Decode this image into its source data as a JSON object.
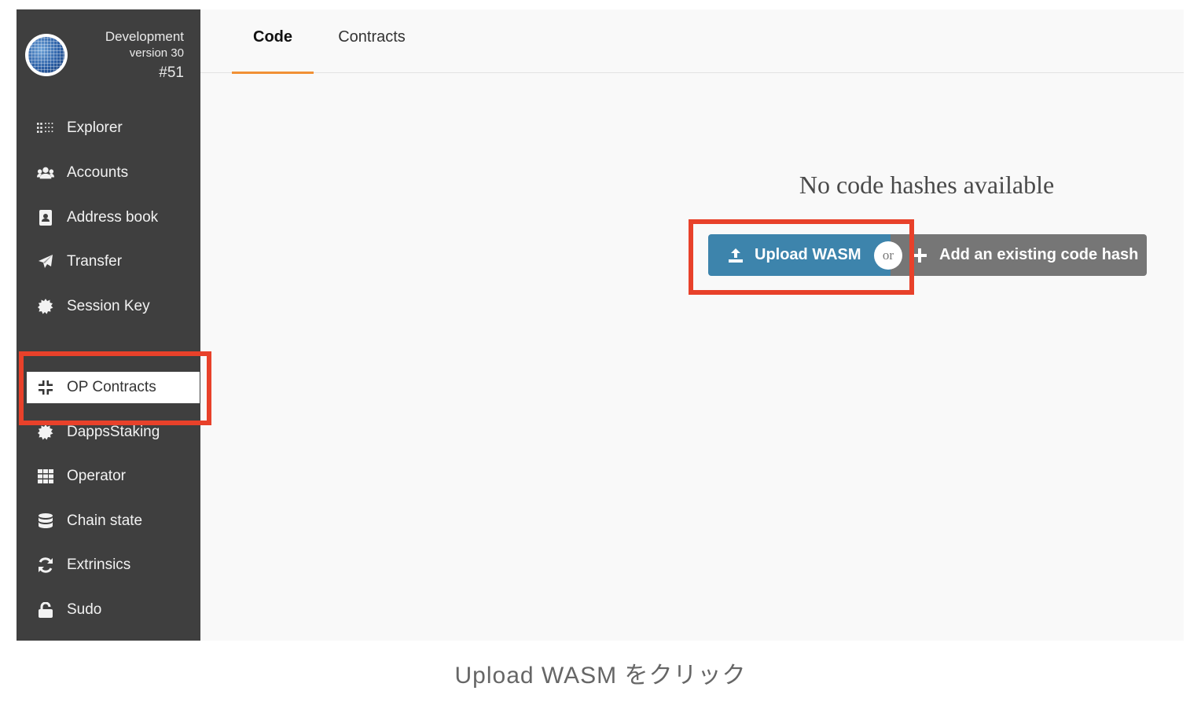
{
  "chain": {
    "name": "Development",
    "version": "version 30",
    "block": "#51"
  },
  "sidebar": {
    "items": [
      {
        "label": "Explorer",
        "icon": "explorer-dots-icon"
      },
      {
        "label": "Accounts",
        "icon": "users-icon"
      },
      {
        "label": "Address book",
        "icon": "address-book-icon"
      },
      {
        "label": "Transfer",
        "icon": "paper-plane-icon"
      },
      {
        "label": "Session Key",
        "icon": "certificate-icon"
      },
      {
        "label": "OP Contracts",
        "icon": "compress-icon"
      },
      {
        "label": "DappsStaking",
        "icon": "certificate-icon"
      },
      {
        "label": "Operator",
        "icon": "grid-icon"
      },
      {
        "label": "Chain state",
        "icon": "database-icon"
      },
      {
        "label": "Extrinsics",
        "icon": "sync-icon"
      },
      {
        "label": "Sudo",
        "icon": "unlock-icon"
      }
    ],
    "active": "OP Contracts"
  },
  "tabs": [
    {
      "label": "Code",
      "active": true
    },
    {
      "label": "Contracts",
      "active": false
    }
  ],
  "main": {
    "empty_message": "No code hashes available",
    "upload_label": "Upload WASM",
    "or_label": "or",
    "add_label": "Add an existing code hash"
  },
  "caption": "Upload WASM をクリック",
  "colors": {
    "sidebar_bg": "#3f3f3f",
    "upload_button": "#3d84ac",
    "add_button": "#767676",
    "tab_accent": "#f19135",
    "highlight": "#e8412a"
  }
}
